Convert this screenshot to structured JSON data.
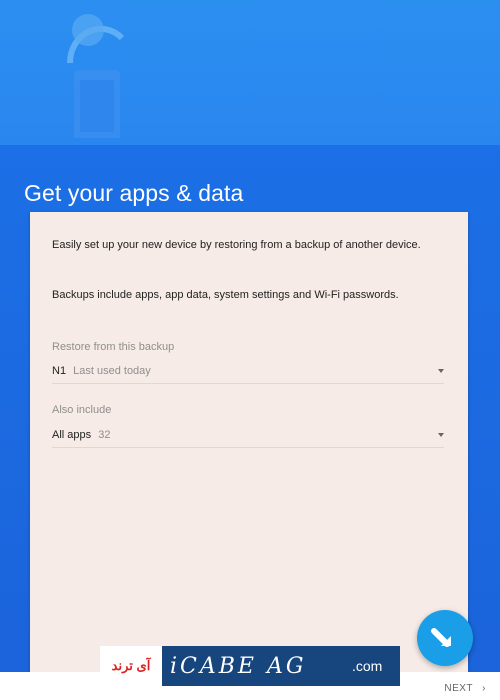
{
  "screen": {
    "title": "Get your apps & data"
  },
  "card": {
    "intro": "Easily set up your new device by restoring from a backup of another device.",
    "backups_info": "Backups include apps, app data, system settings and Wi-Fi passwords.",
    "restore_label": "Restore from this backup",
    "restore_value": "N1",
    "restore_hint": "Last used today",
    "also_label": "Also include",
    "also_value": "All apps",
    "also_count": "32"
  },
  "nav": {
    "next_label": "NEXT",
    "next_chevron": "›"
  },
  "watermark": {
    "left_text": "آی ترند",
    "mid_text": "iCABE AG",
    "com_text": ".com"
  },
  "icons": {
    "illustration": "phone-restore-illustration",
    "fab": "arrow-icon"
  },
  "colors": {
    "header_blue": "#2b8ff0",
    "body_blue": "#1c6fe6",
    "card": "#f6ebe6",
    "fab": "#1a9ee8"
  }
}
